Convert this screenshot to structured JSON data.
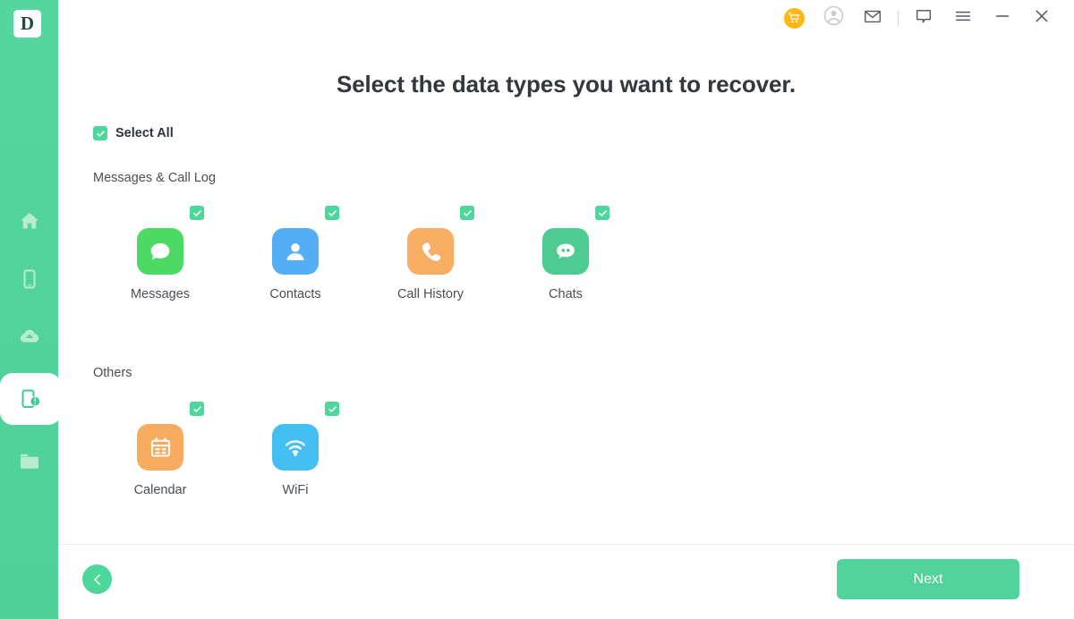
{
  "app": {
    "logo_letter": "D",
    "accent_color": "#4dd79c",
    "sidebar_color": "#53d49b"
  },
  "sidebar": {
    "items": [
      {
        "name": "home",
        "icon": "home-icon",
        "active": false
      },
      {
        "name": "device",
        "icon": "phone-icon",
        "active": false
      },
      {
        "name": "backup",
        "icon": "cloud-upload-icon",
        "active": false
      },
      {
        "name": "recover",
        "icon": "phone-alert-icon",
        "active": true
      },
      {
        "name": "files",
        "icon": "folder-icon",
        "active": false
      }
    ]
  },
  "titlebar": {
    "buttons": [
      {
        "name": "cart-button",
        "icon": "cart-icon",
        "color": "#fdb813"
      },
      {
        "name": "account-button",
        "icon": "user-circle-icon",
        "color": "#c9c9c9"
      },
      {
        "name": "mail-button",
        "icon": "envelope-icon",
        "color": "#4a4f55"
      },
      {
        "name": "feedback-button",
        "icon": "chat-bubble-icon",
        "color": "#4a4f55"
      },
      {
        "name": "menu-button",
        "icon": "hamburger-icon",
        "color": "#4a4f55"
      },
      {
        "name": "minimize-button",
        "icon": "minimize-icon",
        "color": "#4a4f55"
      },
      {
        "name": "close-button",
        "icon": "close-icon",
        "color": "#4a4f55"
      }
    ]
  },
  "main": {
    "title": "Select the data types you want to recover.",
    "select_all": {
      "label": "Select All",
      "checked": true
    },
    "sections": [
      {
        "title": "Messages & Call Log",
        "items": [
          {
            "label": "Messages",
            "icon": "message-bubble-icon",
            "color": "#4cd964",
            "checked": true
          },
          {
            "label": "Contacts",
            "icon": "contact-person-icon",
            "color": "#53aef6",
            "checked": true
          },
          {
            "label": "Call History",
            "icon": "phone-handset-icon",
            "color": "#f8ad63",
            "checked": true
          },
          {
            "label": "Chats",
            "icon": "chat-dots-icon",
            "color": "#4ecb93",
            "checked": true
          }
        ]
      },
      {
        "title": "Others",
        "items": [
          {
            "label": "Calendar",
            "icon": "calendar-icon",
            "color": "#f7ab5e",
            "checked": true
          },
          {
            "label": "WiFi",
            "icon": "wifi-icon",
            "color": "#45bff2",
            "checked": true
          }
        ]
      }
    ]
  },
  "footer": {
    "back_label": "",
    "next_label": "Next"
  }
}
